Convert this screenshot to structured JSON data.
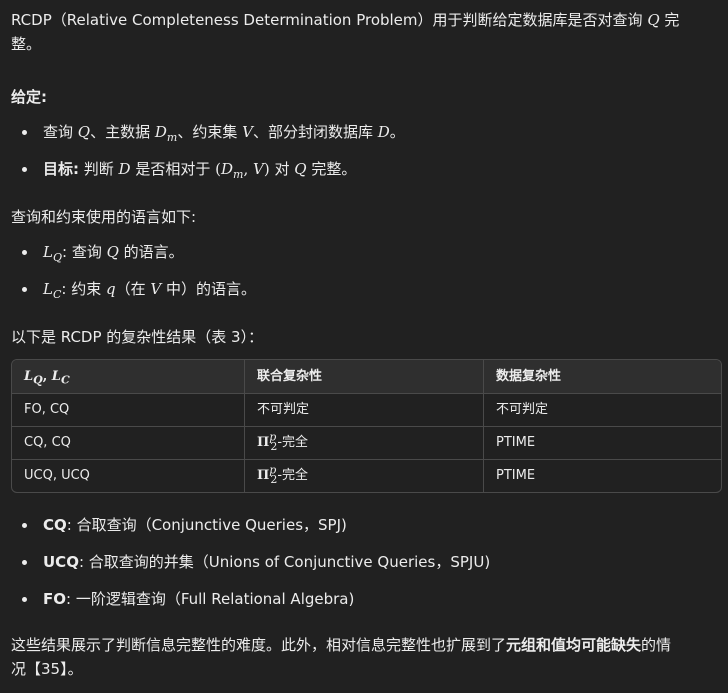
{
  "intro": {
    "prefix": "RCDP（Relative Completeness Determination Problem）用于判断给定数据库是否对查询",
    "q_symbol": "Q",
    "suffix_1": " 完",
    "suffix_2": "整。"
  },
  "given": {
    "heading": "给定:",
    "item1": {
      "text_a": "查询 ",
      "q": "Q",
      "text_b": "、主数据 ",
      "dm_base": "D",
      "dm_sub": "m",
      "text_c": "、约束集 ",
      "v": "V",
      "text_d": "、部分封闭数据库 ",
      "d": "D",
      "text_e": "。"
    },
    "item2": {
      "label": "目标:",
      "text_a": " 判断 ",
      "d": "D",
      "text_b": " 是否相对于 ",
      "paren_open": "(",
      "dm_base": "D",
      "dm_sub": "m",
      "comma": ", ",
      "v": "V",
      "paren_close": ")",
      "text_c": " 对 ",
      "q": "Q",
      "text_d": " 完整。"
    }
  },
  "languages": {
    "intro": "查询和约束使用的语言如下:",
    "lq": {
      "base": "L",
      "sub": "Q",
      "text_a": ": 查询 ",
      "q": "Q",
      "text_b": " 的语言。"
    },
    "lc": {
      "base": "L",
      "sub": "C",
      "text_a": ": 约束 ",
      "q": "q",
      "text_b": "（在 ",
      "v": "V",
      "text_c": " 中）的语言。"
    }
  },
  "results": {
    "intro": "以下是 RCDP 的复杂性结果（表 3）："
  },
  "table": {
    "header": {
      "col1_lq_base": "L",
      "col1_lq_sub": "Q",
      "col1_sep": ", ",
      "col1_lc_base": "L",
      "col1_lc_sub": "C",
      "col2": "联合复杂性",
      "col3": "数据复杂性"
    },
    "rows": [
      {
        "lang": "FO, CQ",
        "combined": "不可判定",
        "data": "不可判定"
      },
      {
        "lang": "CQ, CQ",
        "pi": "Π",
        "pi_sup": "p",
        "pi_sub": "2",
        "combined_suffix": "-完全",
        "data": "PTIME"
      },
      {
        "lang": "UCQ, UCQ",
        "pi": "Π",
        "pi_sup": "p",
        "pi_sub": "2",
        "combined_suffix": "-完全",
        "data": "PTIME"
      }
    ]
  },
  "definitions": [
    {
      "term": "CQ",
      "desc": ": 合取查询（Conjunctive Queries，SPJ)"
    },
    {
      "term": "UCQ",
      "desc": ": 合取查询的并集（Unions of Conjunctive Queries，SPJU)"
    },
    {
      "term": "FO",
      "desc": ": 一阶逻辑查询（Full Relational Algebra)"
    }
  ],
  "conclusion": {
    "text_a": "这些结果展示了判断信息完整性的难度。此外，相对信息完整性也扩展到了",
    "bold": "元组和值均可能缺失",
    "text_b": "的情",
    "line2": "况【35】。"
  }
}
